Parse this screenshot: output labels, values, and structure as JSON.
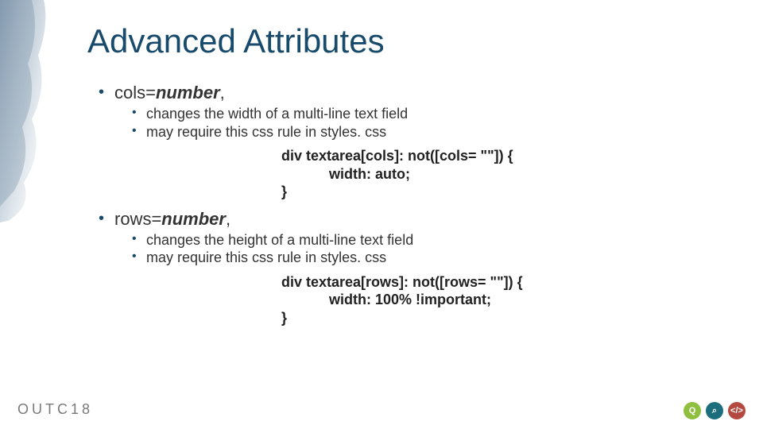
{
  "title": "Advanced Attributes",
  "bullets": [
    {
      "label_prefix": "cols=",
      "label_param": "number",
      "label_suffix": ",",
      "sub": [
        "changes the width of a multi-line text field",
        "may require this css rule in styles. css"
      ],
      "code": "div textarea[cols]: not([cols= \"\"]) {\n            width: auto;\n}"
    },
    {
      "label_prefix": "rows=",
      "label_param": "number",
      "label_suffix": ",",
      "sub": [
        "changes the height of a multi-line text field",
        "may require this css rule in styles. css"
      ],
      "code": "div textarea[rows]: not([rows= \"\"]) {\n            width: 100% !important;\n}"
    }
  ],
  "footer": {
    "brand": "OUTC18"
  },
  "icons": {
    "chat": "Q",
    "search": "⌕",
    "code": "</>"
  }
}
